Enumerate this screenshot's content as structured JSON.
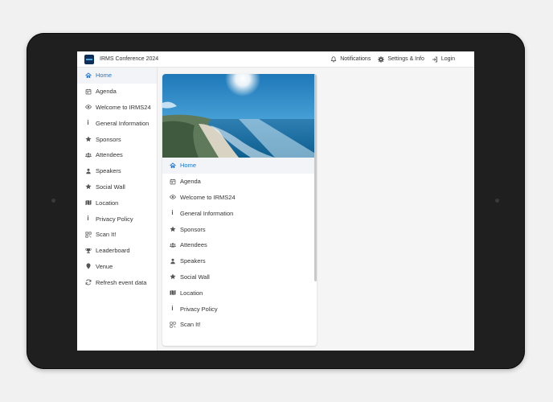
{
  "app": {
    "title": "IRMS Conference 2024"
  },
  "header": {
    "actions": [
      {
        "label": "Notifications",
        "icon": "bell-icon"
      },
      {
        "label": "Settings & Info",
        "icon": "gear-icon"
      },
      {
        "label": "Login",
        "icon": "login-icon"
      }
    ]
  },
  "nav": {
    "items": [
      {
        "label": "Home",
        "icon": "home-icon"
      },
      {
        "label": "Agenda",
        "icon": "calendar-icon"
      },
      {
        "label": "Welcome to IRMS24",
        "icon": "eye-icon"
      },
      {
        "label": "General Information",
        "icon": "info-icon"
      },
      {
        "label": "Sponsors",
        "icon": "star-icon"
      },
      {
        "label": "Attendees",
        "icon": "users-icon"
      },
      {
        "label": "Speakers",
        "icon": "user-icon"
      },
      {
        "label": "Social Wall",
        "icon": "star-icon"
      },
      {
        "label": "Location",
        "icon": "map-icon"
      },
      {
        "label": "Privacy Policy",
        "icon": "info-icon"
      },
      {
        "label": "Scan It!",
        "icon": "qr-icon"
      },
      {
        "label": "Leaderboard",
        "icon": "trophy-icon"
      },
      {
        "label": "Venue",
        "icon": "pin-icon"
      },
      {
        "label": "Refresh event data",
        "icon": "refresh-icon"
      }
    ]
  },
  "colors": {
    "accent": "#1976d2",
    "text": "#333333",
    "active_bg": "#f2f4f7"
  }
}
